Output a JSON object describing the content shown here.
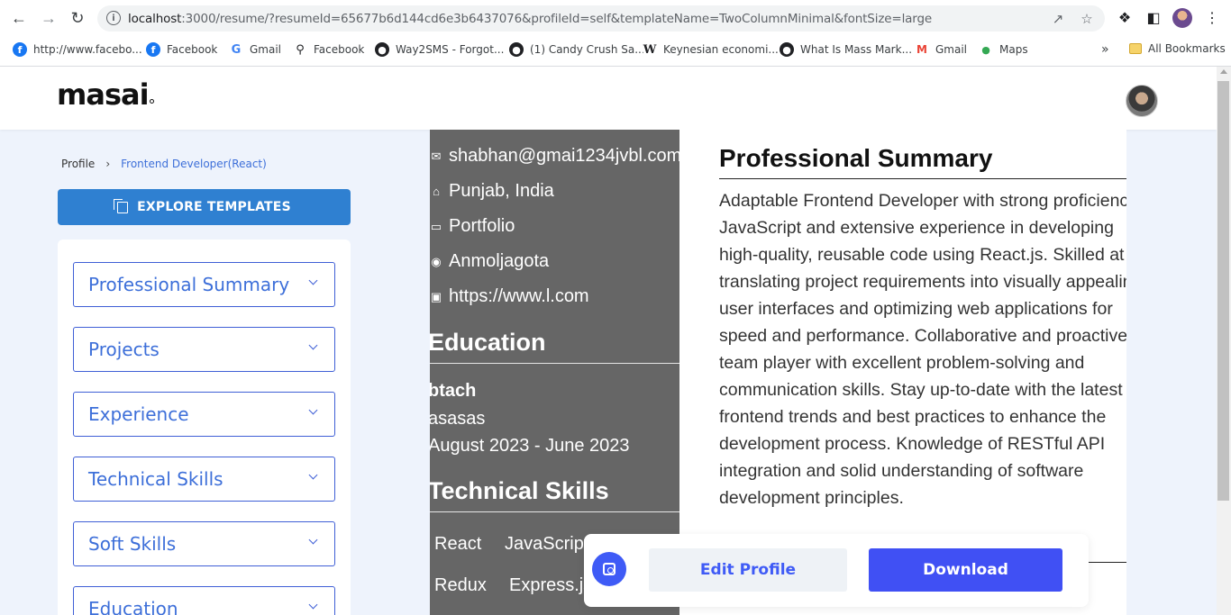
{
  "browser": {
    "url_host": "localhost",
    "url_rest": ":3000/resume/?resumeId=65677b6d144cd6e3b6437076&profileId=self&templateName=TwoColumnMinimal&fontSize=large",
    "bookmarks": [
      {
        "label": "http://www.facebo...",
        "icon": "facebook-icon"
      },
      {
        "label": "Facebook",
        "icon": "facebook-icon"
      },
      {
        "label": "Gmail",
        "icon": "google-icon"
      },
      {
        "label": "Facebook",
        "icon": "key-icon"
      },
      {
        "label": "Way2SMS - Forgot...",
        "icon": "globe-icon"
      },
      {
        "label": "(1) Candy Crush Sa...",
        "icon": "globe-icon"
      },
      {
        "label": "Keynesian economi...",
        "icon": "wikipedia-icon"
      },
      {
        "label": "What Is Mass Mark...",
        "icon": "globe-icon"
      },
      {
        "label": "Gmail",
        "icon": "gmail-icon"
      },
      {
        "label": "Maps",
        "icon": "maps-icon"
      }
    ],
    "more_bookmarks": "»",
    "all_bookmarks": "All Bookmarks"
  },
  "header": {
    "logo": "masai"
  },
  "breadcrumb": {
    "root": "Profile",
    "separator": "›",
    "current": "Frontend Developer(React)"
  },
  "explore_button": "EXPLORE TEMPLATES",
  "sections": [
    "Professional Summary",
    "Projects",
    "Experience",
    "Technical Skills",
    "Soft Skills",
    "Education"
  ],
  "resume": {
    "contacts": [
      {
        "icon": "email-icon",
        "text": "shabhan@gmai1234jvbl.com"
      },
      {
        "icon": "home-icon",
        "text": "Punjab, India"
      },
      {
        "icon": "folder-icon",
        "text": "Portfolio"
      },
      {
        "icon": "github-icon",
        "text": "Anmoljagota"
      },
      {
        "icon": "linkedin-icon",
        "text": "https://www.l.com"
      }
    ],
    "education_title": "Education",
    "education": {
      "degree": "btach",
      "school": "asasas",
      "dates": "August 2023 - June 2023"
    },
    "skills_title": "Technical Skills",
    "skills": [
      "React",
      "JavaScript",
      "Redux",
      "Express.js"
    ],
    "summary_title": "Professional Summary",
    "summary": "Adaptable Frontend Developer with strong proficiency in JavaScript and extensive experience in developing high-quality, reusable code using React.js. Skilled at translating project requirements into visually appealing user interfaces and optimizing web applications for speed and performance. Collaborative and proactive team player with excellent problem-solving and communication skills. Stay up-to-date with the latest frontend trends and best practices to enhance the development process. Knowledge of RESTful API integration and solid understanding of software development principles."
  },
  "actions": {
    "edit": "Edit Profile",
    "download": "Download"
  },
  "colors": {
    "accent": "#3f5bf6",
    "explore": "#2f80d1",
    "sidebar_dark": "#666666"
  }
}
